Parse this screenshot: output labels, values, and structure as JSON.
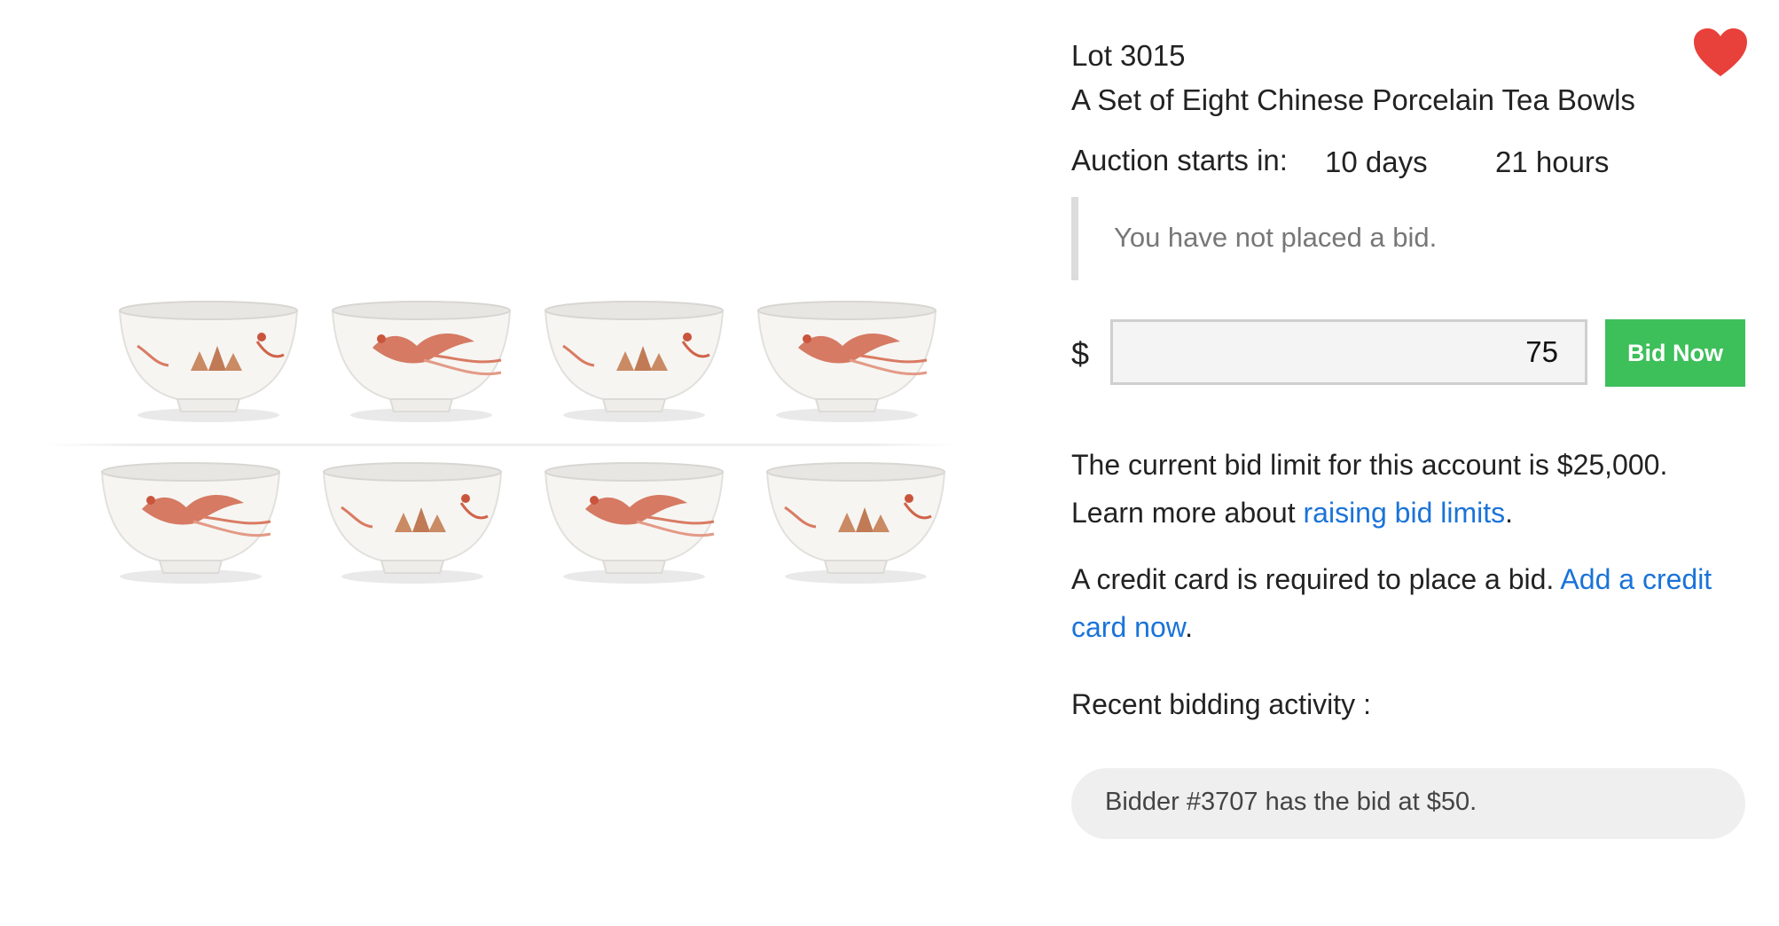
{
  "lot": {
    "label": "Lot 3015",
    "title": "A Set of Eight Chinese Porcelain Tea Bowls"
  },
  "countdown": {
    "label": "Auction starts in:",
    "days": "10 days",
    "hours": "21 hours"
  },
  "bid_status": "You have not placed a bid.",
  "bid_form": {
    "currency": "$",
    "amount": "75",
    "button_label": "Bid Now"
  },
  "bid_limit": {
    "text": "The current bid limit for this account is $25,000.",
    "learn_prefix": "Learn more about ",
    "link_label": "raising bid limits",
    "suffix": "."
  },
  "credit_card": {
    "text": "A credit card is required to place a bid. ",
    "link_label": "Add a credit card now",
    "suffix": "."
  },
  "recent_activity": {
    "heading": "Recent bidding activity :",
    "entries": [
      "Bidder #3707 has the bid at $50."
    ]
  },
  "icons": {
    "favorite": "heart-icon"
  },
  "colors": {
    "accent_green": "#3dbf5a",
    "link_blue": "#1a73d9",
    "heart_red": "#e8403a"
  }
}
